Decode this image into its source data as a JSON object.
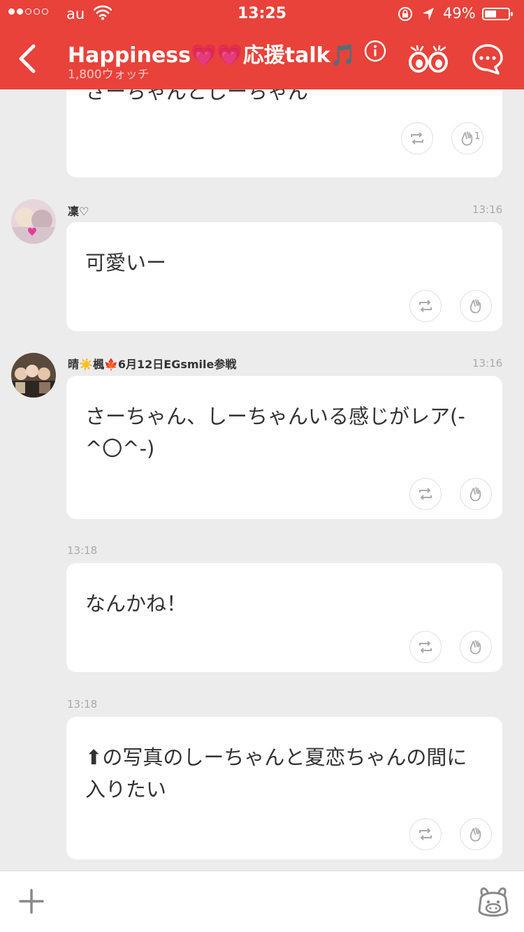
{
  "status_bar": {
    "carrier": "au",
    "time": "13:25",
    "battery_percent": "49%",
    "battery_level": 0.49,
    "signal_bars_filled": 2,
    "signal_bars_total": 5
  },
  "nav": {
    "title_main": "Happiness",
    "title_emoji_1": "💗",
    "title_emoji_2": "💗",
    "title_after": "応援talk",
    "title_note": "🎵",
    "watchers": "1,800ウォッチ",
    "accent_color": "#e8423a"
  },
  "messages": [
    {
      "text": "さーちゃんとしーちゃん",
      "clap_count": "1"
    },
    {
      "username": "凜♡",
      "time": "13:16",
      "text": "可愛いー"
    },
    {
      "username_prefix": "晴",
      "username_emoji_1": "☀️",
      "username_mid": "楓",
      "username_emoji_2": "🍁",
      "username_suffix": "6月12日EGsmile参戦",
      "time": "13:16",
      "text": "さーちゃん、しーちゃんいる感じがレア(-^〇^-)"
    },
    {
      "time": "13:18",
      "text": "なんかね！"
    },
    {
      "time": "13:18",
      "text_arrow": "⬆",
      "text": "の写真のしーちゃんと夏恋ちゃんの間に入りたい"
    }
  ],
  "icons": {
    "back": "chevron-left-icon",
    "info": "info-icon",
    "watch": "eyes-icon",
    "chat": "chat-bubble-icon",
    "share": "repost-icon",
    "clap": "clap-hand-icon",
    "add": "plus-icon",
    "stamp": "mascot-icon"
  }
}
